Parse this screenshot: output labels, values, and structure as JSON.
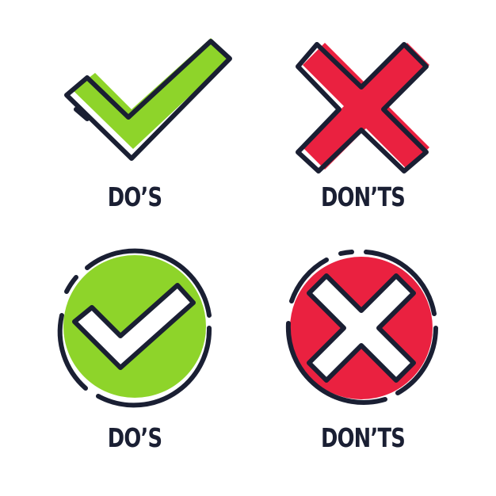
{
  "captions": {
    "top_left": "DO’S",
    "top_right": "DON’TS",
    "bottom_left": "DO’S",
    "bottom_right": "DON’TS"
  },
  "colors": {
    "check_green": "#8ed42a",
    "cross_red": "#ea2140",
    "outline_navy": "#1a1f33",
    "background": "#ffffff"
  },
  "icons": [
    {
      "name": "check-mark-icon"
    },
    {
      "name": "cross-mark-icon"
    },
    {
      "name": "check-circle-icon"
    },
    {
      "name": "cross-circle-icon"
    }
  ]
}
